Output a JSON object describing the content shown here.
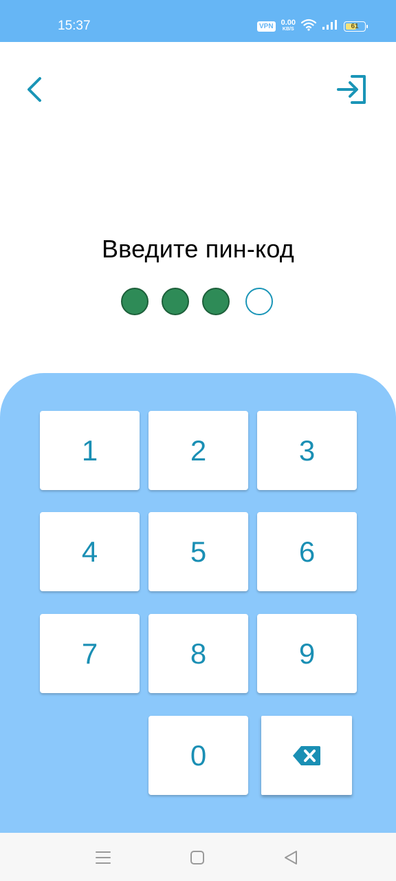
{
  "status_bar": {
    "time": "15:37",
    "vpn_label": "VPN",
    "net_speed_value": "0.00",
    "net_speed_unit": "KB/S",
    "battery_level": "61",
    "battery_fraction": 0.61,
    "background_color": "#66b6f5"
  },
  "header": {
    "back_icon": "chevron-left-icon",
    "login_icon": "login-icon",
    "icon_color": "#1a95b7"
  },
  "pin": {
    "title": "Введите пин-код",
    "length": 4,
    "entered": 3,
    "filled_color": "#2e8b57",
    "empty_border_color": "#1a95b7"
  },
  "keypad": {
    "panel_color": "#8bc8fb",
    "digit_color": "#1a8fb4",
    "keys": [
      "1",
      "2",
      "3",
      "4",
      "5",
      "6",
      "7",
      "8",
      "9",
      "0"
    ],
    "delete_icon": "backspace-icon"
  },
  "nav_bar": {
    "items": [
      "menu-icon",
      "home-icon",
      "back-triangle-icon"
    ]
  }
}
